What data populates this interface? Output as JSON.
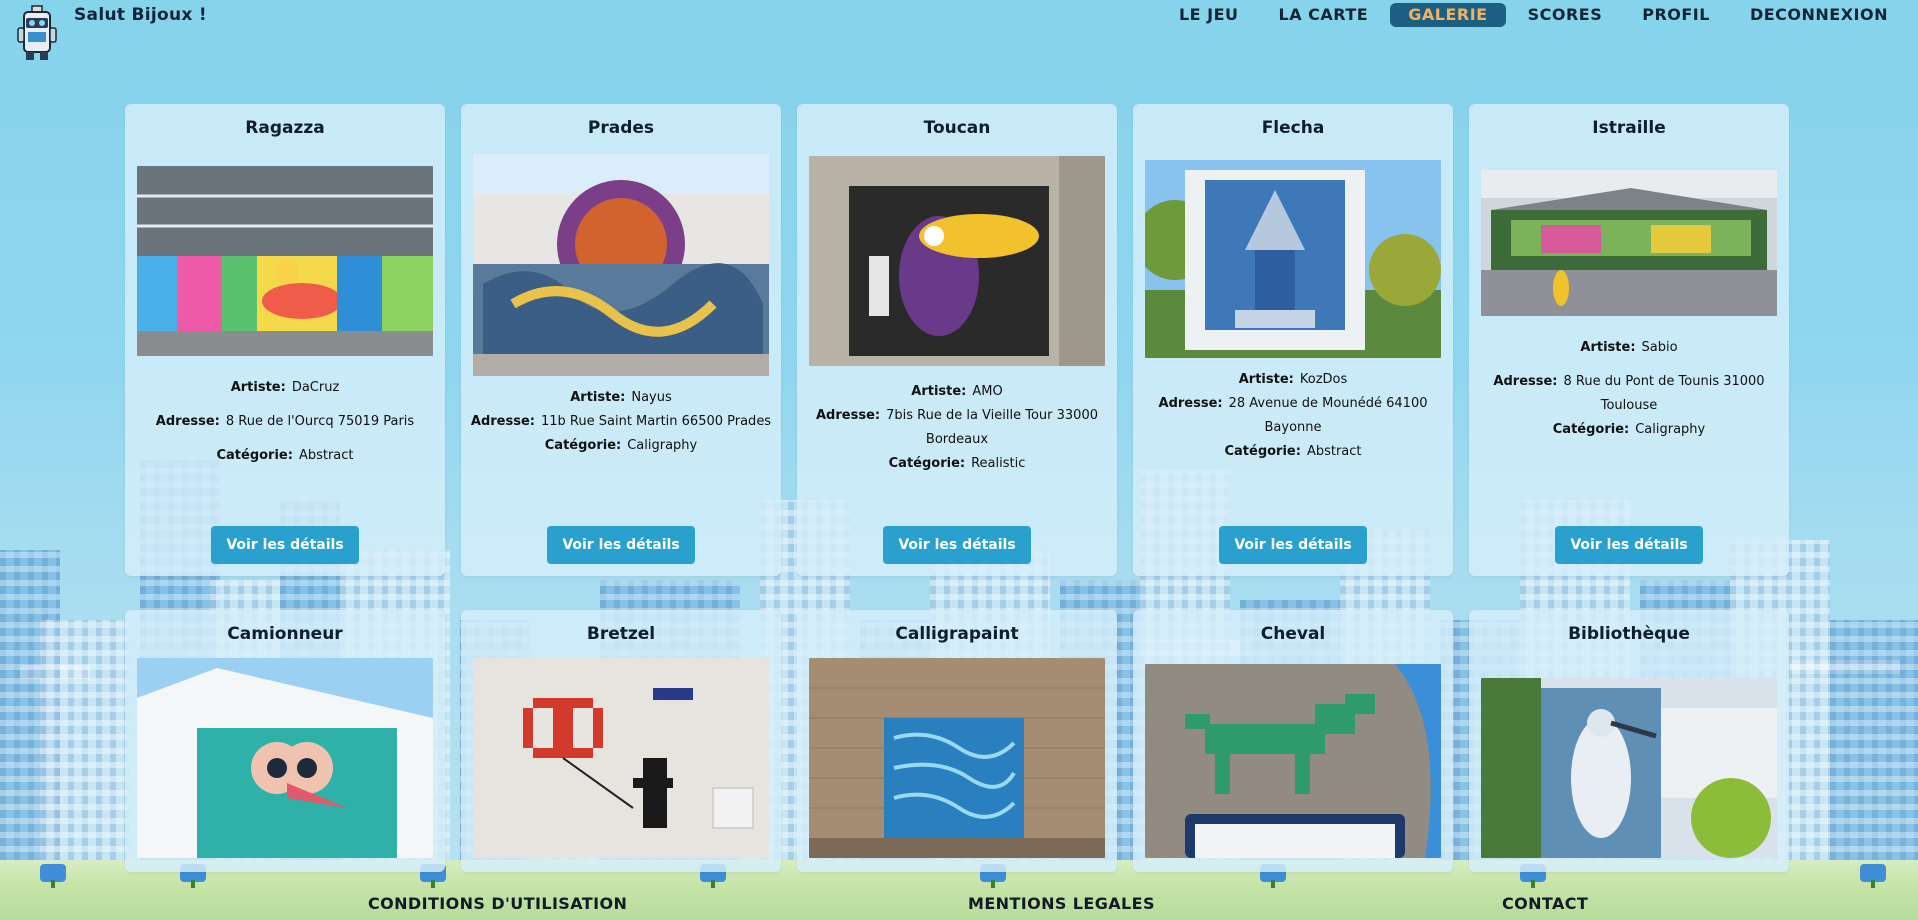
{
  "header": {
    "greeting": "Salut Bijoux !",
    "nav": [
      {
        "label": "LE JEU"
      },
      {
        "label": "LA CARTE"
      },
      {
        "label": "GALERIE",
        "active": true
      },
      {
        "label": "SCORES"
      },
      {
        "label": "PROFIL"
      },
      {
        "label": "DECONNEXION"
      }
    ],
    "logo_icon": "robot-spraycan-mascot-icon"
  },
  "labels": {
    "artist": "Artiste:",
    "address": "Adresse:",
    "category": "Catégorie:",
    "details_button": "Voir les détails"
  },
  "cards": [
    {
      "title": "Ragazza",
      "artist": "DaCruz",
      "address": "8 Rue de l'Ourcq 75019 Paris",
      "category": "Abstract",
      "image": "mural-colorful-reclining-figure"
    },
    {
      "title": "Prades",
      "artist": "Nayus",
      "address": "11b Rue Saint Martin 66500 Prades",
      "category": "Caligraphy",
      "image": "mural-graffiti-wildstyle"
    },
    {
      "title": "Toucan",
      "artist": "AMO",
      "address": "7bis Rue de la Vieille Tour 33000 Bordeaux",
      "category": "Realistic",
      "image": "mural-toucan-on-door"
    },
    {
      "title": "Flecha",
      "artist": "KozDos",
      "address": "28 Avenue de Mounédé 64100 Bayonne",
      "category": "Abstract",
      "image": "mural-figure-on-building"
    },
    {
      "title": "Istraille",
      "artist": "Sabio",
      "address": "8 Rue du Pont de Tounis 31000 Toulouse",
      "category": "Caligraphy",
      "image": "mural-hall-panorama"
    },
    {
      "title": "Camionneur",
      "image": "mural-bird-on-building"
    },
    {
      "title": "Bretzel",
      "image": "mural-pixel-pretzel-balloon"
    },
    {
      "title": "Calligrapaint",
      "image": "mural-calligraphy-electric-box"
    },
    {
      "title": "Cheval",
      "image": "mural-pixel-horse"
    },
    {
      "title": "Bibliothèque",
      "image": "mural-heron-on-library"
    }
  ],
  "footer": {
    "links": [
      {
        "label": "CONDITIONS D'UTILISATION"
      },
      {
        "label": "MENTIONS LEGALES"
      },
      {
        "label": "CONTACT"
      }
    ]
  },
  "colors": {
    "accent": "#2aa0cf",
    "nav_active_bg": "#1d5f80",
    "nav_active_text": "#f2b266",
    "sky": "#86d3ec"
  }
}
